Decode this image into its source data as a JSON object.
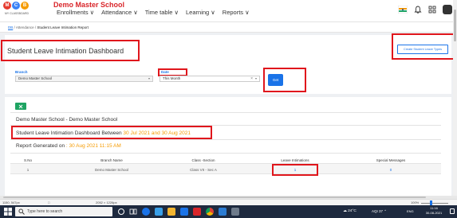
{
  "app": {
    "school_name": "Demo Master School",
    "logo_letters": [
      "M",
      "C",
      "B"
    ],
    "logo_sub": "MY CLASSBOARD",
    "nav": [
      "Enrollments ∨",
      "Attendance ∨",
      "Time table ∨",
      "Learning ∨",
      "Reports ∨"
    ]
  },
  "breadcrumb": {
    "home": "DB",
    "sep": "/",
    "section": "Attendance",
    "current": "Student Leave Intimation Report"
  },
  "page": {
    "title": "Student Leave Intimation Dashboard",
    "create_button": "Create Student Leave Types"
  },
  "filters": {
    "branch_label": "Branch",
    "branch_value": "Demo Master School",
    "date_label": "Date",
    "date_value": "This Month",
    "date_clear": "×",
    "get_button": "Get"
  },
  "report": {
    "excel_icon": "excel-icon",
    "school_line": "Demo Master School - Demo Master School",
    "between_prefix": "Student Leave Intimation Dashboard Between ",
    "between_dates": "30 Jul 2021 and 30 Aug 2021",
    "generated_prefix": "Report Generated on ",
    "generated_date": ": 30 Aug 2021 11:15 AM",
    "columns": [
      "S.No",
      "Branch Name",
      "Class -Section",
      "Leave Intimations",
      "Special Messages"
    ],
    "rows": [
      {
        "sno": "1",
        "branch": "Demo Master School",
        "class_section": "Class VII - Sec A",
        "leave_intimations": "1",
        "special_messages": "0"
      }
    ]
  },
  "statusbar": {
    "position": "1150, 547px",
    "size": "2052 × 1226px",
    "zoom": "100%"
  },
  "taskbar": {
    "search_placeholder": "Type here to search",
    "weather": "24°C",
    "aqi": "AQI 37",
    "lang": "ENG",
    "time": "11:16",
    "date": "30-08-2021"
  },
  "colors": {
    "accent": "#1a73e8",
    "brand_red": "#d9252a",
    "highlight_box": "#e0161c",
    "orange": "#f59b00",
    "excel_green": "#1fa463",
    "taskbar": "#1e2a3f"
  }
}
